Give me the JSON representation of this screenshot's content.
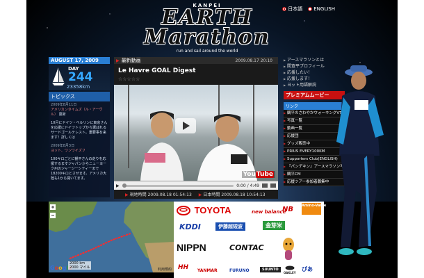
{
  "header": {
    "brand_top": "KANPEI",
    "logo_line1": "EARTH",
    "logo_line2": "Marathon",
    "tagline": "run and sail around the world",
    "lang_ja": "日本語",
    "lang_en": "ENGLISH"
  },
  "status": {
    "date": "AUGUST 17, 2009",
    "day_label": "DAY",
    "day_number": "244",
    "distance": "23358km"
  },
  "topics": {
    "heading": "トピックス",
    "items": [
      {
        "date": "2009年8月11日",
        "link": "アメリカンタイムズ（ル・アーヴル）",
        "label": "更新"
      },
      {
        "text": "10月にドイツ・ベルリンに東京さんを応援にドイツトップから選ばれるサードゴールテレスト。重要事を来ます！詳しくは"
      },
      {
        "date": "2009年8月3日",
        "link": "ヨット、ワンワイズフ",
        "label": ""
      },
      {
        "text": "100キロごとに観平さんの走りを応援するますジャパンからニューヨーク州のジャージーシティーまで18200キロとさせます。アメリカ大陸も1から開いてます。"
      }
    ]
  },
  "video": {
    "section_label": "最新動画",
    "date": "2009.08.17 20:10",
    "title": "Le Havre GOAL Digest",
    "stars": "☆☆☆☆☆",
    "duration": "0:00 / 4:49",
    "local_time_label": "現地時間",
    "local_time": "2009.08.18 01:54:13",
    "japan_time_label": "日本時間",
    "japan_time": "2009.08.18 10:54:13",
    "brand": "YouTube"
  },
  "sidebar": {
    "top_links": [
      "アースマラソンとは",
      "間寛平プロフィール",
      "応援したい！",
      "応援します！",
      "ヨット用語解説"
    ],
    "premium_label": "プレミアムムービー",
    "links_label": "リンク",
    "links": [
      "観平のさわやかウォーキングVTR（大阪ニューヨーク）",
      "写真一覧",
      "動画一覧",
      "応援団",
      "グッズ販売中",
      "PRIUS EVERY100KM",
      "Supporters Club(ENGLISH)",
      "『パンデキン』アースマラソン写真",
      "観平CM",
      "応援ツアー参加者募集中"
    ]
  },
  "map": {
    "brand": "Google",
    "scale_km": "2000 km",
    "scale_mi": "2000 マイル",
    "copyright": "利用規約"
  },
  "sponsors": {
    "toyota": "TOYOTA",
    "newbalance": "new balance",
    "amino": "Amino-Value",
    "kddi": "KDDI",
    "itoen": "伊藤超短波",
    "kinmatsu": "金芽米",
    "nippn": "NIPPN",
    "contac": "CONTAC",
    "hh": "HH",
    "yanmar": "YANMAR",
    "furuno": "FURUNO",
    "suunto": "SUUNTO",
    "oakley": "OAKLEY",
    "pia": "ぴあ"
  },
  "colors": {
    "accent_blue": "#2a7fd4",
    "accent_red": "#c81010"
  }
}
